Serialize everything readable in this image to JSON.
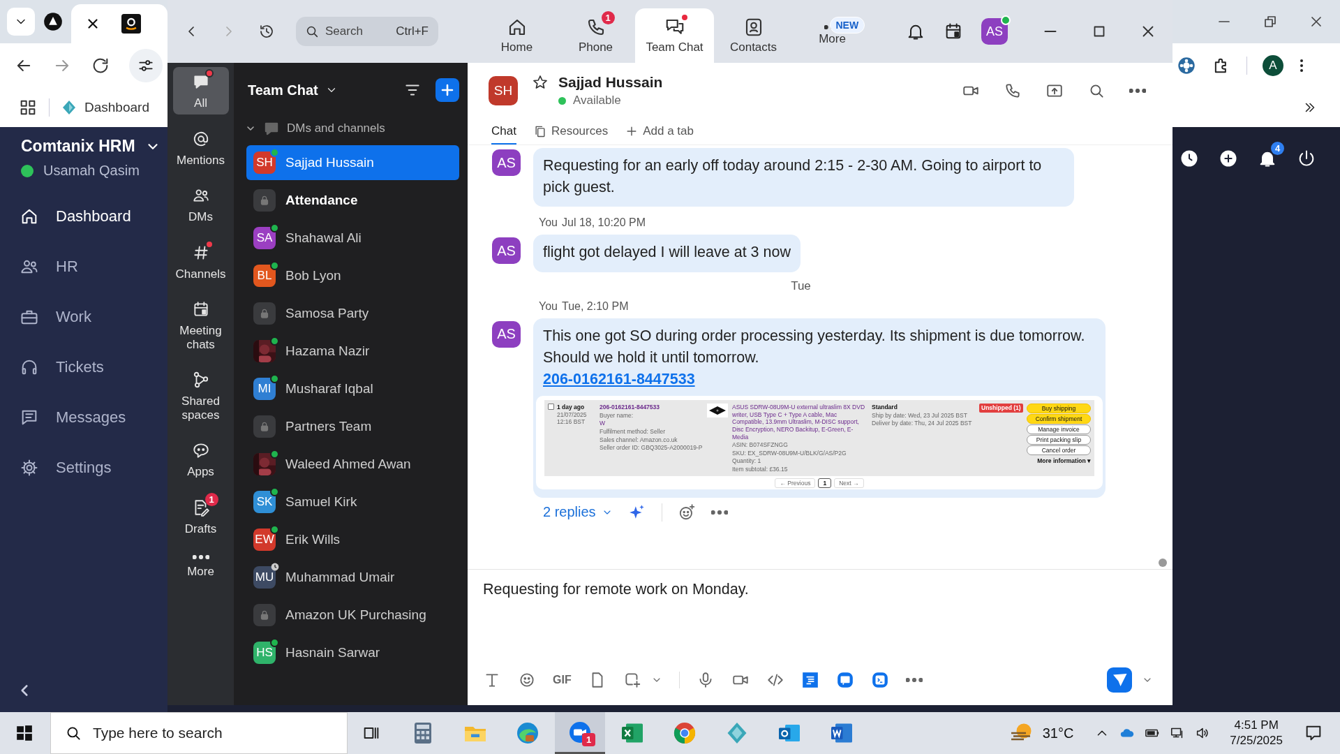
{
  "browser": {
    "bookmark": "Dashboard",
    "notification_badge": "4",
    "profile_initial": "A"
  },
  "hrm_sidebar": {
    "title": "Comtanix HRM",
    "user": "Usamah Qasim",
    "items": [
      {
        "label": "Dashboard",
        "selected": true
      },
      {
        "label": "HR",
        "selected": false
      },
      {
        "label": "Work",
        "selected": false
      },
      {
        "label": "Tickets",
        "selected": false
      },
      {
        "label": "Messages",
        "selected": false
      },
      {
        "label": "Settings",
        "selected": false
      }
    ]
  },
  "zoom": {
    "search": {
      "placeholder": "Search",
      "shortcut": "Ctrl+F"
    },
    "nav_tabs": [
      {
        "label": "Home",
        "selected": false
      },
      {
        "label": "Phone",
        "badge": "1",
        "selected": false
      },
      {
        "label": "Team Chat",
        "dot": true,
        "selected": true
      },
      {
        "label": "Contacts",
        "selected": false
      },
      {
        "label": "More",
        "tag": "NEW",
        "selected": false
      }
    ],
    "user_avatar": "AS",
    "rail": [
      {
        "label": "All",
        "selected": true,
        "dot": true
      },
      {
        "label": "Mentions",
        "selected": false
      },
      {
        "label": "DMs",
        "selected": false
      },
      {
        "label": "Channels",
        "selected": false,
        "dot": true
      },
      {
        "label": "Meeting chats",
        "selected": false
      },
      {
        "label": "Shared spaces",
        "selected": false
      },
      {
        "label": "Apps",
        "selected": false
      },
      {
        "label": "Drafts",
        "selected": false,
        "badge": "1"
      },
      {
        "label": "More",
        "selected": false
      }
    ],
    "list": {
      "title": "Team Chat",
      "section": "DMs and channels",
      "expanded": true,
      "items": [
        {
          "name": "Sajjad Hussain",
          "kind": "person",
          "initials": "SH",
          "color": "#d2392b",
          "online": true,
          "away": false,
          "selected": true,
          "unread": false
        },
        {
          "name": "Attendance",
          "kind": "channel",
          "online": false,
          "away": false,
          "selected": false,
          "unread": true
        },
        {
          "name": "Shahawal Ali",
          "kind": "person",
          "initials": "SA",
          "color": "#9b3fc2",
          "online": true,
          "away": false,
          "selected": false,
          "unread": false
        },
        {
          "name": "Bob Lyon",
          "kind": "person",
          "initials": "BL",
          "color": "#e2571e",
          "online": true,
          "away": false,
          "selected": false,
          "unread": false
        },
        {
          "name": "Samosa Party",
          "kind": "channel",
          "online": false,
          "away": false,
          "selected": false,
          "unread": false
        },
        {
          "name": "Hazama Nazir",
          "online": true,
          "away": false,
          "selected": false,
          "unread": false
        },
        {
          "name": "Musharaf Iqbal",
          "kind": "person",
          "initials": "MI",
          "color": "#2f7fd3",
          "online": true,
          "away": false,
          "selected": false,
          "unread": false
        },
        {
          "name": "Partners Team",
          "kind": "channel",
          "online": false,
          "away": false,
          "selected": false,
          "unread": false
        },
        {
          "name": "Waleed Ahmed Awan",
          "online": true,
          "away": false,
          "selected": false,
          "unread": false
        },
        {
          "name": "Samuel Kirk",
          "kind": "person",
          "initials": "SK",
          "color": "#2f8fd6",
          "online": true,
          "away": false,
          "selected": false,
          "unread": false
        },
        {
          "name": "Erik Wills",
          "kind": "person",
          "initials": "EW",
          "color": "#d2392b",
          "online": true,
          "away": false,
          "selected": false,
          "unread": false
        },
        {
          "name": "Muhammad Umair",
          "kind": "person",
          "initials": "MU",
          "color": "#3d4a63",
          "online": false,
          "away": true,
          "selected": false,
          "unread": false
        },
        {
          "name": "Amazon UK Purchasing",
          "kind": "channel",
          "online": false,
          "away": false,
          "selected": false,
          "unread": false
        },
        {
          "name": "Hasnain Sarwar",
          "kind": "person",
          "initials": "HS",
          "color": "#2fb36a",
          "online": true,
          "away": false,
          "selected": false,
          "unread": false
        }
      ]
    },
    "chat": {
      "contact": {
        "initials": "SH",
        "color": "#c0392b",
        "name": "Sajjad Hussain",
        "status": "Available",
        "starred": false
      },
      "tabs": [
        {
          "label": "Chat",
          "kind": "plain",
          "selected": true
        },
        {
          "label": "Resources",
          "kind": "files",
          "selected": false
        },
        {
          "label": "Add a tab",
          "kind": "add",
          "selected": false
        }
      ],
      "messages": [
        {
          "kind": "message",
          "avatar": "AS",
          "text": "Requesting for an early off today around 2:15 - 2-30 AM. Going to airport to pick guest."
        },
        {
          "kind": "message",
          "avatar": "AS",
          "sender": "You",
          "time": "Jul 18, 10:20 PM",
          "text": "flight got delayed I will leave at 3 now"
        },
        {
          "kind": "date",
          "label": "Tue"
        },
        {
          "kind": "message",
          "avatar": "AS",
          "sender": "You",
          "time": "Tue, 2:10 PM",
          "text": "This one got SO during order processing yesterday. Its shipment is due tomorrow. Should we hold it until tomorrow.",
          "link": "206-0162161-8447533",
          "attachment": {
            "checked": false,
            "order_date": [
              "1 day ago",
              "21/07/2025",
              "12:16 BST"
            ],
            "order_details": [
              "206-0162161-8447533",
              "Buyer name:",
              "W",
              "Fulfilment method: Seller",
              "Sales channel: Amazon.co.uk",
              "Seller order ID: GBQ3025-A2000019-P"
            ],
            "product": "ASUS SDRW-08U9M-U external ultraslim 8X DVD writer, USB Type C + Type A cable, Mac Compatible, 13.9mm Ultraslim, M-DISC support, Disc Encryption, NERO Backitup, E-Green, E-Media",
            "product_meta": [
              "ASIN: B074SFZNGG",
              "SKU: EX_SDRW-08U9M-U/BLK/G/AS/P2G",
              "Quantity: 1",
              "Item subtotal: £36.15"
            ],
            "order_type": "Standard",
            "order_type_meta": [
              "Ship by date: Wed, 23 Jul 2025 BST",
              "Deliver by date: Thu, 24 Jul 2025 BST"
            ],
            "status": "Unshipped (1)",
            "actions": [
              {
                "label": "Buy shipping",
                "primary": true
              },
              {
                "label": "Confirm shipment",
                "primary": true
              },
              {
                "label": "Manage invoice",
                "primary": false
              },
              {
                "label": "Print packing slip",
                "primary": false
              },
              {
                "label": "Cancel order",
                "primary": false
              }
            ],
            "more": "More information ▾",
            "pager": [
              {
                "label": "← Previous",
                "selected": false
              },
              {
                "label": "1",
                "selected": true
              },
              {
                "label": "Next →",
                "selected": false
              }
            ]
          },
          "replies": "2 replies"
        }
      ]
    },
    "composer": {
      "value": "Requesting for remote work on Monday.",
      "gif_label": "GIF"
    }
  },
  "taskbar": {
    "search_placeholder": "Type here to search",
    "zoom_badge": "1",
    "temperature": "31°C",
    "time": "4:51 PM",
    "date": "7/25/2025"
  }
}
